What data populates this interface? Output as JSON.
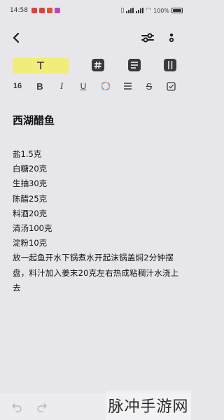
{
  "status_bar": {
    "time": "14:58",
    "battery": "100%",
    "notification_colors": [
      "#d6453d",
      "#d6453d",
      "#e0503a",
      "#b44bb8"
    ]
  },
  "note": {
    "title": "西湖醋鱼",
    "date": "",
    "lines": [
      "盐1.5克",
      "白糖20克",
      "生抽30克",
      "陈醋25克",
      "料酒20克",
      "清汤100克",
      "淀粉10克"
    ],
    "paragraph": "放一起鱼开水下锅煮水开起沫锅盖焖2分钟摆盘，料汁加入姜末20克左右热成粘稠汁水浇上去"
  },
  "toolbar": {
    "font_size": "16",
    "icons": [
      "bold-icon",
      "italic-icon",
      "underline-icon",
      "color-wheel-icon",
      "list-icon",
      "strikethrough-icon",
      "checkbox-icon"
    ]
  },
  "format_row": {
    "icons": [
      "text-style-icon",
      "hashtag-icon",
      "paragraph-list-icon",
      "columns-icon"
    ],
    "highlight_color": "#f2ec78"
  },
  "watermark": {
    "text": "脉冲手游网"
  }
}
